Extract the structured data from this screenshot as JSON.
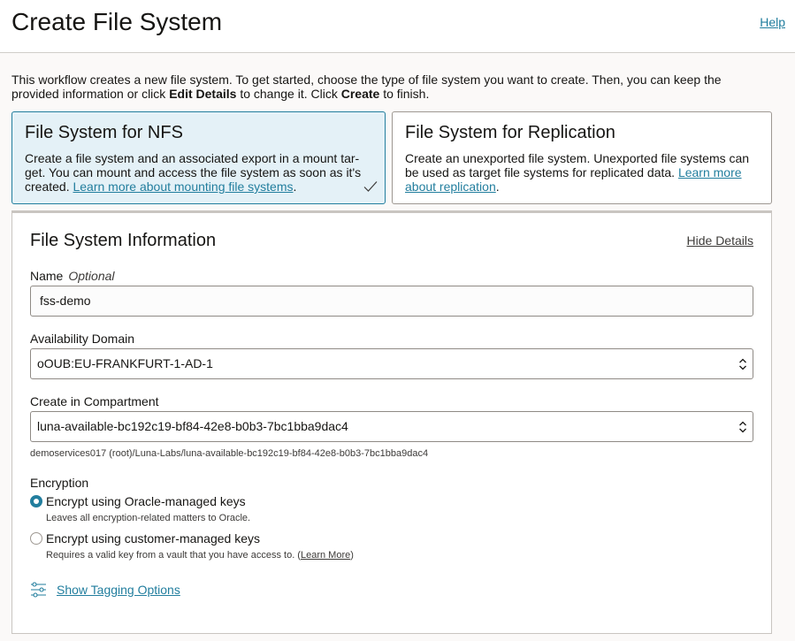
{
  "header": {
    "title": "Create File System",
    "help_label": "Help"
  },
  "intro": {
    "part1": "This workflow creates a new file system. To get started, choose the type of file system you want to create. Then, you can keep the provided information or click ",
    "bold1": "Edit Details",
    "part2": " to change it. Click ",
    "bold2": "Create",
    "part3": " to finish."
  },
  "cards": {
    "nfs": {
      "title": "File System for NFS",
      "desc": "Create a file system and an associated export in a mount tar-get. You can mount and access the file system as soon as it's created. ",
      "link": "Learn more about mounting file systems",
      "after": ".",
      "selected": true
    },
    "replication": {
      "title": "File System for Replication",
      "desc": "Create an unexported file system. Unexported file systems can be used as target file systems for replicated data. ",
      "link": "Learn more about replication",
      "after": ".",
      "selected": false
    }
  },
  "panel": {
    "title": "File System Information",
    "hide_details": "Hide Details",
    "name": {
      "label": "Name",
      "optional": "Optional",
      "value": "fss-demo"
    },
    "availability_domain": {
      "label": "Availability Domain",
      "value": "oOUB:EU-FRANKFURT-1-AD-1"
    },
    "compartment": {
      "label": "Create in Compartment",
      "value": "luna-available-bc192c19-bf84-42e8-b0b3-7bc1bba9dac4",
      "path": "demoservices017 (root)/Luna-Labs/luna-available-bc192c19-bf84-42e8-b0b3-7bc1bba9dac4"
    },
    "encryption": {
      "label": "Encryption",
      "options": [
        {
          "label": "Encrypt using Oracle-managed keys",
          "help": "Leaves all encryption-related matters to Oracle.",
          "checked": true
        },
        {
          "label": "Encrypt using customer-managed keys",
          "help": "Requires a valid key from a vault that you have access to. (",
          "help_link": "Learn More",
          "help_after": ")",
          "checked": false
        }
      ]
    },
    "tagging": {
      "label": "Show Tagging Options"
    }
  },
  "colors": {
    "accent": "#227e9e",
    "selected_card_bg": "#e4f1f7",
    "text": "#161513"
  },
  "icons": [
    "check-icon",
    "up-down-chevron-icon",
    "sliders-icon"
  ]
}
